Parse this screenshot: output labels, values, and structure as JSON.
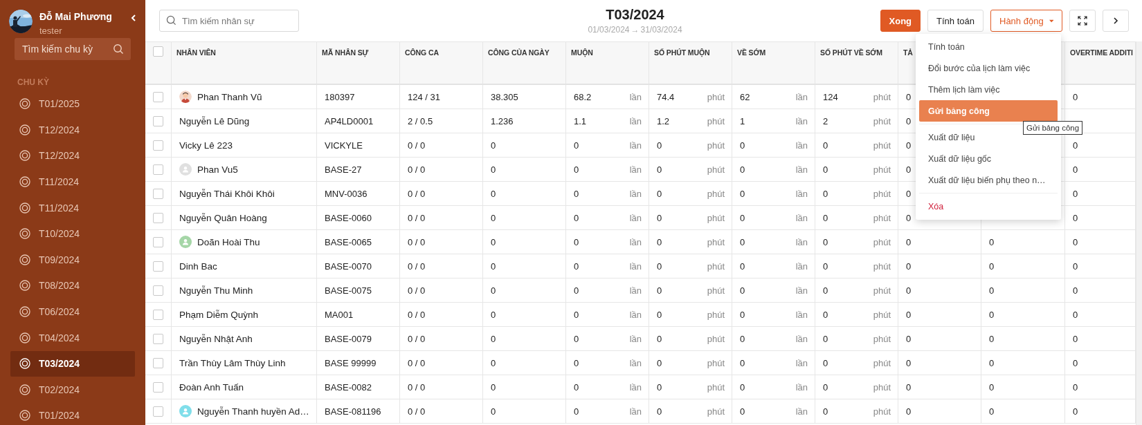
{
  "sidebar": {
    "user": {
      "name": "Đỗ Mai Phương",
      "role": "tester"
    },
    "search": {
      "placeholder": "Tìm kiếm chu kỳ"
    },
    "section_title": "CHU KỲ",
    "items": [
      {
        "label": "T01/2025",
        "selected": false
      },
      {
        "label": "T12/2024",
        "selected": false
      },
      {
        "label": "T12/2024",
        "selected": false
      },
      {
        "label": "T11/2024",
        "selected": false
      },
      {
        "label": "T11/2024",
        "selected": false
      },
      {
        "label": "T10/2024",
        "selected": false
      },
      {
        "label": "T09/2024",
        "selected": false
      },
      {
        "label": "T08/2024",
        "selected": false
      },
      {
        "label": "T06/2024",
        "selected": false
      },
      {
        "label": "T04/2024",
        "selected": false
      },
      {
        "label": "T03/2024",
        "selected": true
      },
      {
        "label": "T02/2024",
        "selected": false
      },
      {
        "label": "T01/2024",
        "selected": false
      }
    ]
  },
  "header": {
    "search": {
      "placeholder": "Tìm kiếm nhân sự"
    },
    "title": "T03/2024",
    "date_from": "01/03/2024",
    "date_arrow": "→",
    "date_to": "31/03/2024",
    "buttons": [
      {
        "label": "Xong",
        "kind": "primary"
      },
      {
        "label": "Tính toán",
        "kind": "default"
      },
      {
        "label": "Hành động",
        "kind": "dropdown"
      }
    ]
  },
  "action_menu": {
    "groups": [
      [
        {
          "label": "Tính toán",
          "selected": false,
          "kind": "normal"
        },
        {
          "label": "Đổi bước của lịch làm việc",
          "selected": false,
          "kind": "normal"
        },
        {
          "label": "Thêm lịch làm việc",
          "selected": false,
          "kind": "normal"
        },
        {
          "label": "Gửi bảng công",
          "selected": true,
          "kind": "normal"
        }
      ],
      [
        {
          "label": "Xuất dữ liệu",
          "selected": false,
          "kind": "normal"
        },
        {
          "label": "Xuất dữ liệu gốc",
          "selected": false,
          "kind": "normal"
        },
        {
          "label": "Xuất dữ liệu biến phụ theo n…",
          "selected": false,
          "kind": "normal"
        }
      ],
      [
        {
          "label": "Xóa",
          "selected": false,
          "kind": "danger"
        }
      ]
    ]
  },
  "tooltip": {
    "text": "Gửi bảng công"
  },
  "table": {
    "select_all_checked": false,
    "columns": [
      "NHÂN VIÊN",
      "MÃ NHÂN SỰ",
      "CÔNG CA",
      "CÔNG CỦA NGÀY",
      "MUỘN",
      "SỐ PHÚT MUỘN",
      "VỀ SỚM",
      "SỐ PHÚT VỀ SỚM",
      "TẢ",
      null,
      "OVERTIME ADDITI"
    ],
    "rows": [
      {
        "checked": false,
        "cells": [
          {
            "text": "Phan Thanh Vũ"
          },
          {
            "text": "180397"
          },
          {
            "text": "124 / 31"
          },
          {
            "text": "38.305"
          },
          {
            "text": "68.2",
            "unit": "lần"
          },
          {
            "text": "74.4",
            "unit": "phút"
          },
          {
            "text": "62",
            "unit": "lần"
          },
          {
            "text": "124",
            "unit": "phút"
          },
          {
            "text": "0"
          },
          null,
          {
            "text": "0"
          }
        ]
      },
      {
        "checked": false,
        "cells": [
          {
            "text": "Nguyễn Lê Dũng"
          },
          {
            "text": "AP4LD0001"
          },
          {
            "text": "2 / 0.5"
          },
          {
            "text": "1.236"
          },
          {
            "text": "1.1",
            "unit": "lần"
          },
          {
            "text": "1.2",
            "unit": "phút"
          },
          {
            "text": "1",
            "unit": "lần"
          },
          {
            "text": "2",
            "unit": "phút"
          },
          {
            "text": "0"
          },
          null,
          null
        ]
      },
      {
        "checked": false,
        "cells": [
          {
            "text": "Vicky Lê 223"
          },
          {
            "text": "VICKYLE"
          },
          {
            "text": "0 / 0"
          },
          {
            "text": "0"
          },
          {
            "text": "0",
            "unit": "lần"
          },
          {
            "text": "0",
            "unit": "phút"
          },
          {
            "text": "0",
            "unit": "lần"
          },
          {
            "text": "0",
            "unit": "phút"
          },
          {
            "text": "0"
          },
          null,
          {
            "text": "0"
          }
        ]
      },
      {
        "checked": false,
        "cells": [
          {
            "text": "Phan Vu5",
            "avatar": {
              "kind": "icon",
              "color": "#e0e0e0"
            }
          },
          {
            "text": "BASE-27"
          },
          {
            "text": "0 / 0"
          },
          {
            "text": "0"
          },
          {
            "text": "0",
            "unit": "lần"
          },
          {
            "text": "0",
            "unit": "phút"
          },
          {
            "text": "0",
            "unit": "lần"
          },
          {
            "text": "0",
            "unit": "phút"
          },
          {
            "text": "0"
          },
          null,
          {
            "text": "0"
          }
        ]
      },
      {
        "checked": false,
        "cells": [
          {
            "text": "Nguyễn Thái Khôi Khôi"
          },
          {
            "text": "MNV-0036"
          },
          {
            "text": "0 / 0"
          },
          {
            "text": "0"
          },
          {
            "text": "0",
            "unit": "lần"
          },
          {
            "text": "0",
            "unit": "phút"
          },
          {
            "text": "0",
            "unit": "lần"
          },
          {
            "text": "0",
            "unit": "phút"
          },
          {
            "text": "0"
          },
          null,
          {
            "text": "0"
          }
        ]
      },
      {
        "checked": false,
        "cells": [
          {
            "text": "Nguyễn Quân Hoàng"
          },
          {
            "text": "BASE-0060"
          },
          {
            "text": "0 / 0"
          },
          {
            "text": "0"
          },
          {
            "text": "0",
            "unit": "lần"
          },
          {
            "text": "0",
            "unit": "phút"
          },
          {
            "text": "0",
            "unit": "lần"
          },
          {
            "text": "0",
            "unit": "phút"
          },
          {
            "text": "0"
          },
          null,
          {
            "text": "0"
          }
        ]
      },
      {
        "checked": false,
        "cells": [
          {
            "text": "Doãn Hoài Thu",
            "avatar": {
              "kind": "icon",
              "color": "#a5d6a7"
            }
          },
          {
            "text": "BASE-0065"
          },
          {
            "text": "0 / 0"
          },
          {
            "text": "0"
          },
          {
            "text": "0",
            "unit": "lần"
          },
          {
            "text": "0",
            "unit": "phút"
          },
          {
            "text": "0",
            "unit": "lần"
          },
          {
            "text": "0",
            "unit": "phút"
          },
          {
            "text": "0"
          },
          {
            "text": "0"
          },
          {
            "text": "0"
          }
        ]
      },
      {
        "checked": false,
        "cells": [
          {
            "text": "Dinh Bac"
          },
          {
            "text": "BASE-0070"
          },
          {
            "text": "0 / 0"
          },
          {
            "text": "0"
          },
          {
            "text": "0",
            "unit": "lần"
          },
          {
            "text": "0",
            "unit": "phút"
          },
          {
            "text": "0",
            "unit": "lần"
          },
          {
            "text": "0",
            "unit": "phút"
          },
          {
            "text": "0"
          },
          {
            "text": "0"
          },
          {
            "text": "0"
          }
        ]
      },
      {
        "checked": false,
        "cells": [
          {
            "text": "Nguyễn Thu Minh"
          },
          {
            "text": "BASE-0075"
          },
          {
            "text": "0 / 0"
          },
          {
            "text": "0"
          },
          {
            "text": "0",
            "unit": "lần"
          },
          {
            "text": "0",
            "unit": "phút"
          },
          {
            "text": "0",
            "unit": "lần"
          },
          {
            "text": "0",
            "unit": "phút"
          },
          {
            "text": "0"
          },
          {
            "text": "0"
          },
          {
            "text": "0"
          }
        ]
      },
      {
        "checked": false,
        "cells": [
          {
            "text": "Phạm Diễm Quỳnh"
          },
          {
            "text": "MA001"
          },
          {
            "text": "0 / 0"
          },
          {
            "text": "0"
          },
          {
            "text": "0",
            "unit": "lần"
          },
          {
            "text": "0",
            "unit": "phút"
          },
          {
            "text": "0",
            "unit": "lần"
          },
          {
            "text": "0",
            "unit": "phút"
          },
          {
            "text": "0"
          },
          {
            "text": "0"
          },
          {
            "text": "0"
          }
        ]
      },
      {
        "checked": false,
        "cells": [
          {
            "text": "Nguyễn Nhật Anh"
          },
          {
            "text": "BASE-0079"
          },
          {
            "text": "0 / 0"
          },
          {
            "text": "0"
          },
          {
            "text": "0",
            "unit": "lần"
          },
          {
            "text": "0",
            "unit": "phút"
          },
          {
            "text": "0",
            "unit": "lần"
          },
          {
            "text": "0",
            "unit": "phút"
          },
          {
            "text": "0"
          },
          {
            "text": "0"
          },
          {
            "text": "0"
          }
        ]
      },
      {
        "checked": false,
        "cells": [
          {
            "text": "Trần Thùy Lâm Thùy Linh"
          },
          {
            "text": "BASE 99999"
          },
          {
            "text": "0 / 0"
          },
          {
            "text": "0"
          },
          {
            "text": "0",
            "unit": "lần"
          },
          {
            "text": "0",
            "unit": "phút"
          },
          {
            "text": "0",
            "unit": "lần"
          },
          {
            "text": "0",
            "unit": "phút"
          },
          {
            "text": "0"
          },
          {
            "text": "0"
          },
          {
            "text": "0"
          }
        ]
      },
      {
        "checked": false,
        "cells": [
          {
            "text": "Đoàn Anh Tuấn"
          },
          {
            "text": "BASE-0082"
          },
          {
            "text": "0 / 0"
          },
          {
            "text": "0"
          },
          {
            "text": "0",
            "unit": "lần"
          },
          {
            "text": "0",
            "unit": "phút"
          },
          {
            "text": "0",
            "unit": "lần"
          },
          {
            "text": "0",
            "unit": "phút"
          },
          {
            "text": "0"
          },
          {
            "text": "0"
          },
          {
            "text": "0"
          }
        ]
      },
      {
        "checked": false,
        "cells": [
          {
            "text": "Nguyễn Thanh huyền Ad…",
            "avatar": {
              "kind": "icon",
              "color": "#80deea"
            }
          },
          {
            "text": "BASE-081196"
          },
          {
            "text": "0 / 0"
          },
          {
            "text": "0"
          },
          {
            "text": "0",
            "unit": "lần"
          },
          {
            "text": "0",
            "unit": "phút"
          },
          {
            "text": "0",
            "unit": "lần"
          },
          {
            "text": "0",
            "unit": "phút"
          },
          {
            "text": "0"
          },
          {
            "text": "0"
          },
          {
            "text": "0"
          }
        ]
      }
    ]
  }
}
